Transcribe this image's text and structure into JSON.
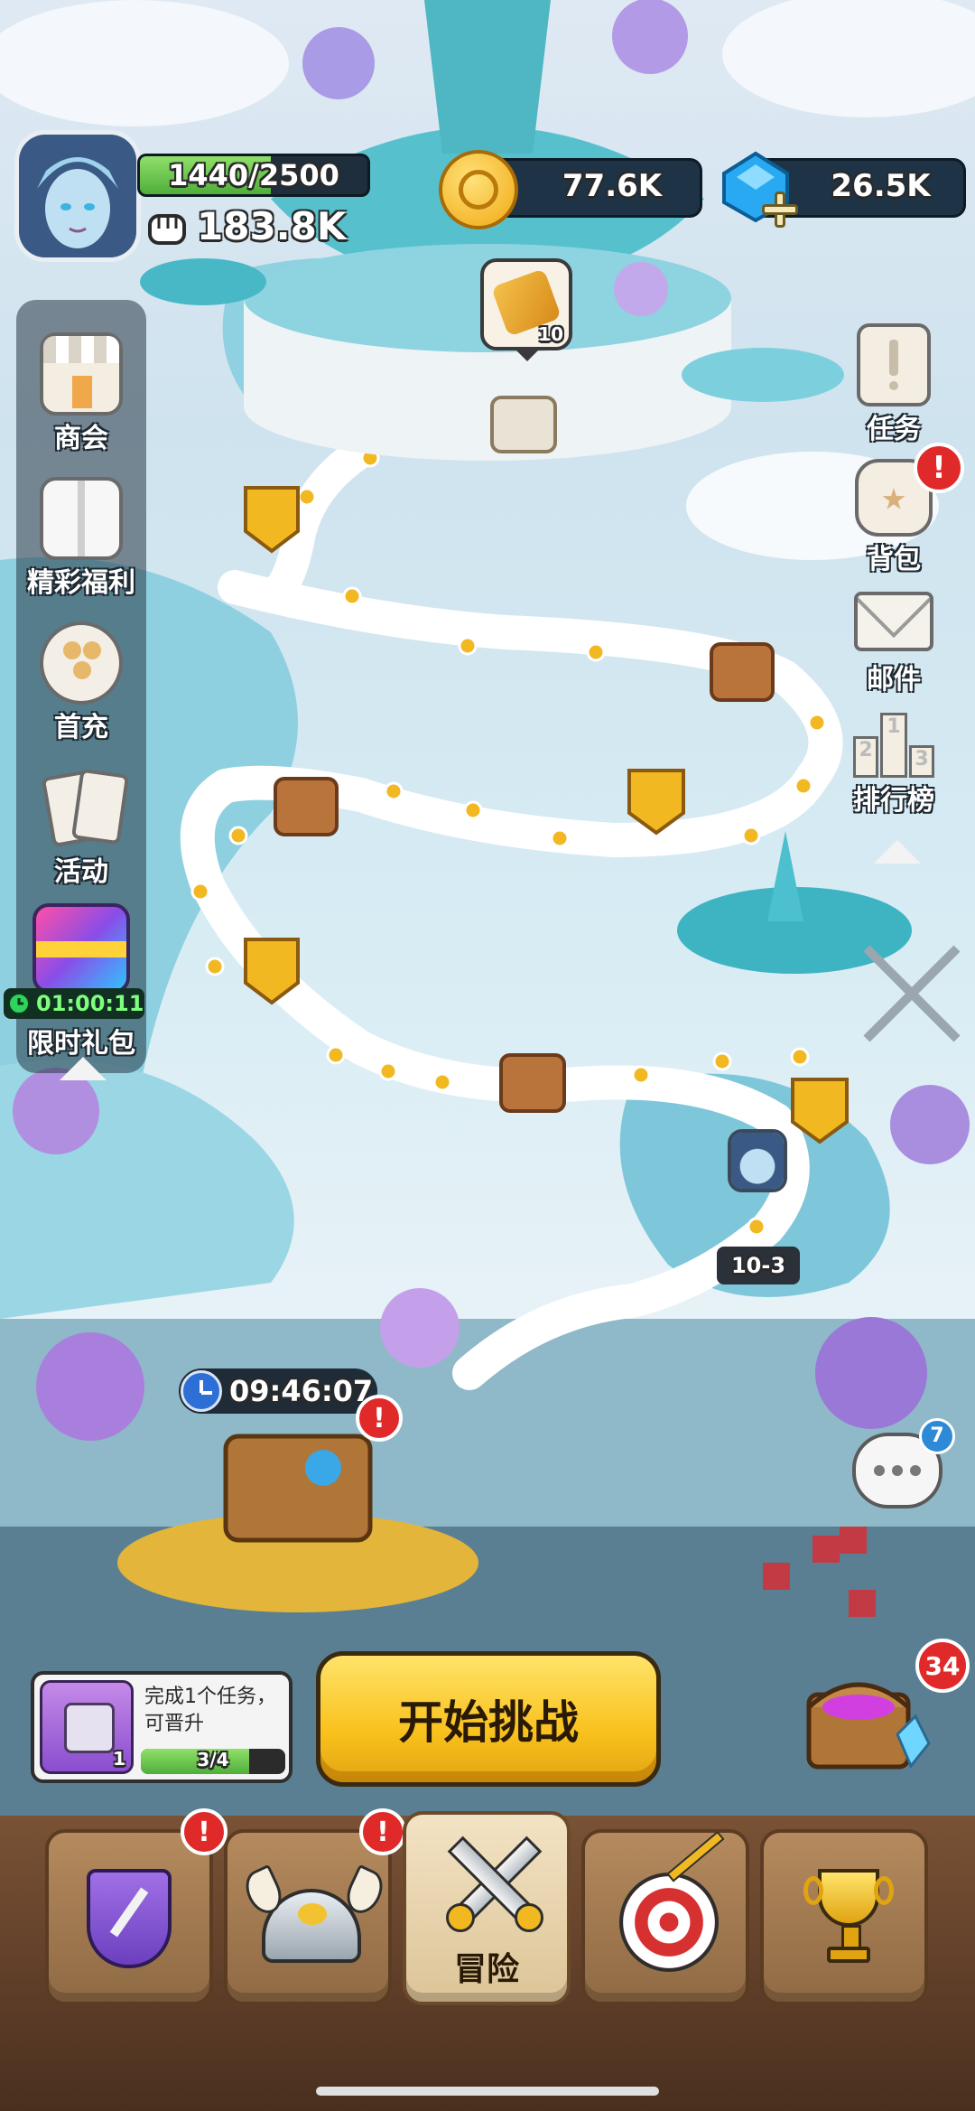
{
  "player": {
    "xp_text": "1440/2500",
    "xp_progress": 0.576,
    "power": "183.8K"
  },
  "currency": {
    "gold": "77.6K",
    "gems": "26.5K"
  },
  "left_menu": {
    "items": [
      {
        "label": "商会",
        "icon": "shop-icon"
      },
      {
        "label": "精彩福利",
        "icon": "gift-box-icon"
      },
      {
        "label": "首充",
        "icon": "coin-bag-icon"
      },
      {
        "label": "活动",
        "icon": "cards-icon"
      },
      {
        "label": "限时礼包",
        "icon": "limited-gift-icon",
        "timer": "01:00:11"
      }
    ]
  },
  "right_menu": {
    "items": [
      {
        "label": "任务",
        "icon": "quest-scroll-icon"
      },
      {
        "label": "背包",
        "icon": "backpack-icon",
        "alert": "!"
      },
      {
        "label": "邮件",
        "icon": "mail-icon"
      },
      {
        "label": "排行榜",
        "icon": "leaderboard-icon"
      }
    ]
  },
  "map": {
    "scroll_reward_count": "10",
    "stage_label": "10-3",
    "chest_timer": "09:46:07",
    "chest_alert": "!"
  },
  "chat": {
    "unread": "7"
  },
  "quest_card": {
    "text": "完成1个任务，可晋升",
    "count": "1",
    "progress_text": "3/4",
    "progress": 0.75
  },
  "start_button": {
    "label": "开始挑战"
  },
  "treasure": {
    "count": "34"
  },
  "bottom_nav": {
    "tabs": [
      {
        "label": "",
        "icon": "shield-sword-icon",
        "alert": "!"
      },
      {
        "label": "",
        "icon": "viking-helmet-icon",
        "alert": "!"
      },
      {
        "label": "冒险",
        "icon": "crossed-swords-icon",
        "active": true
      },
      {
        "label": "",
        "icon": "target-icon"
      },
      {
        "label": "",
        "icon": "trophy-icon"
      }
    ]
  }
}
